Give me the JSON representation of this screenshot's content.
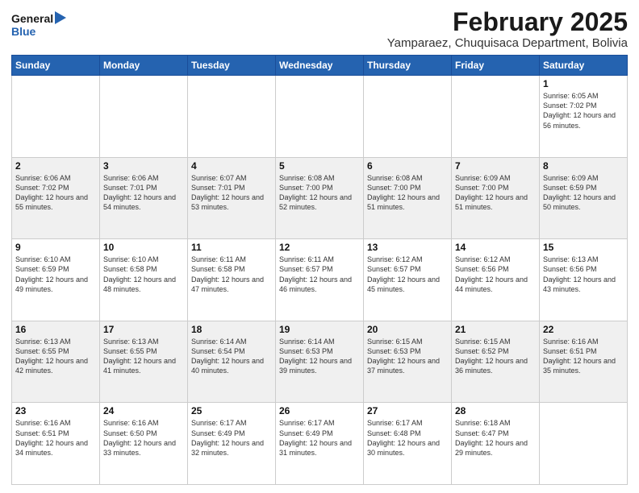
{
  "logo": {
    "line1": "General",
    "line2": "Blue"
  },
  "title": "February 2025",
  "location": "Yamparaez, Chuquisaca Department, Bolivia",
  "days_of_week": [
    "Sunday",
    "Monday",
    "Tuesday",
    "Wednesday",
    "Thursday",
    "Friday",
    "Saturday"
  ],
  "weeks": [
    [
      {
        "day": "",
        "info": ""
      },
      {
        "day": "",
        "info": ""
      },
      {
        "day": "",
        "info": ""
      },
      {
        "day": "",
        "info": ""
      },
      {
        "day": "",
        "info": ""
      },
      {
        "day": "",
        "info": ""
      },
      {
        "day": "1",
        "info": "Sunrise: 6:05 AM\nSunset: 7:02 PM\nDaylight: 12 hours and 56 minutes."
      }
    ],
    [
      {
        "day": "2",
        "info": "Sunrise: 6:06 AM\nSunset: 7:02 PM\nDaylight: 12 hours and 55 minutes."
      },
      {
        "day": "3",
        "info": "Sunrise: 6:06 AM\nSunset: 7:01 PM\nDaylight: 12 hours and 54 minutes."
      },
      {
        "day": "4",
        "info": "Sunrise: 6:07 AM\nSunset: 7:01 PM\nDaylight: 12 hours and 53 minutes."
      },
      {
        "day": "5",
        "info": "Sunrise: 6:08 AM\nSunset: 7:00 PM\nDaylight: 12 hours and 52 minutes."
      },
      {
        "day": "6",
        "info": "Sunrise: 6:08 AM\nSunset: 7:00 PM\nDaylight: 12 hours and 51 minutes."
      },
      {
        "day": "7",
        "info": "Sunrise: 6:09 AM\nSunset: 7:00 PM\nDaylight: 12 hours and 51 minutes."
      },
      {
        "day": "8",
        "info": "Sunrise: 6:09 AM\nSunset: 6:59 PM\nDaylight: 12 hours and 50 minutes."
      }
    ],
    [
      {
        "day": "9",
        "info": "Sunrise: 6:10 AM\nSunset: 6:59 PM\nDaylight: 12 hours and 49 minutes."
      },
      {
        "day": "10",
        "info": "Sunrise: 6:10 AM\nSunset: 6:58 PM\nDaylight: 12 hours and 48 minutes."
      },
      {
        "day": "11",
        "info": "Sunrise: 6:11 AM\nSunset: 6:58 PM\nDaylight: 12 hours and 47 minutes."
      },
      {
        "day": "12",
        "info": "Sunrise: 6:11 AM\nSunset: 6:57 PM\nDaylight: 12 hours and 46 minutes."
      },
      {
        "day": "13",
        "info": "Sunrise: 6:12 AM\nSunset: 6:57 PM\nDaylight: 12 hours and 45 minutes."
      },
      {
        "day": "14",
        "info": "Sunrise: 6:12 AM\nSunset: 6:56 PM\nDaylight: 12 hours and 44 minutes."
      },
      {
        "day": "15",
        "info": "Sunrise: 6:13 AM\nSunset: 6:56 PM\nDaylight: 12 hours and 43 minutes."
      }
    ],
    [
      {
        "day": "16",
        "info": "Sunrise: 6:13 AM\nSunset: 6:55 PM\nDaylight: 12 hours and 42 minutes."
      },
      {
        "day": "17",
        "info": "Sunrise: 6:13 AM\nSunset: 6:55 PM\nDaylight: 12 hours and 41 minutes."
      },
      {
        "day": "18",
        "info": "Sunrise: 6:14 AM\nSunset: 6:54 PM\nDaylight: 12 hours and 40 minutes."
      },
      {
        "day": "19",
        "info": "Sunrise: 6:14 AM\nSunset: 6:53 PM\nDaylight: 12 hours and 39 minutes."
      },
      {
        "day": "20",
        "info": "Sunrise: 6:15 AM\nSunset: 6:53 PM\nDaylight: 12 hours and 37 minutes."
      },
      {
        "day": "21",
        "info": "Sunrise: 6:15 AM\nSunset: 6:52 PM\nDaylight: 12 hours and 36 minutes."
      },
      {
        "day": "22",
        "info": "Sunrise: 6:16 AM\nSunset: 6:51 PM\nDaylight: 12 hours and 35 minutes."
      }
    ],
    [
      {
        "day": "23",
        "info": "Sunrise: 6:16 AM\nSunset: 6:51 PM\nDaylight: 12 hours and 34 minutes."
      },
      {
        "day": "24",
        "info": "Sunrise: 6:16 AM\nSunset: 6:50 PM\nDaylight: 12 hours and 33 minutes."
      },
      {
        "day": "25",
        "info": "Sunrise: 6:17 AM\nSunset: 6:49 PM\nDaylight: 12 hours and 32 minutes."
      },
      {
        "day": "26",
        "info": "Sunrise: 6:17 AM\nSunset: 6:49 PM\nDaylight: 12 hours and 31 minutes."
      },
      {
        "day": "27",
        "info": "Sunrise: 6:17 AM\nSunset: 6:48 PM\nDaylight: 12 hours and 30 minutes."
      },
      {
        "day": "28",
        "info": "Sunrise: 6:18 AM\nSunset: 6:47 PM\nDaylight: 12 hours and 29 minutes."
      },
      {
        "day": "",
        "info": ""
      }
    ]
  ]
}
